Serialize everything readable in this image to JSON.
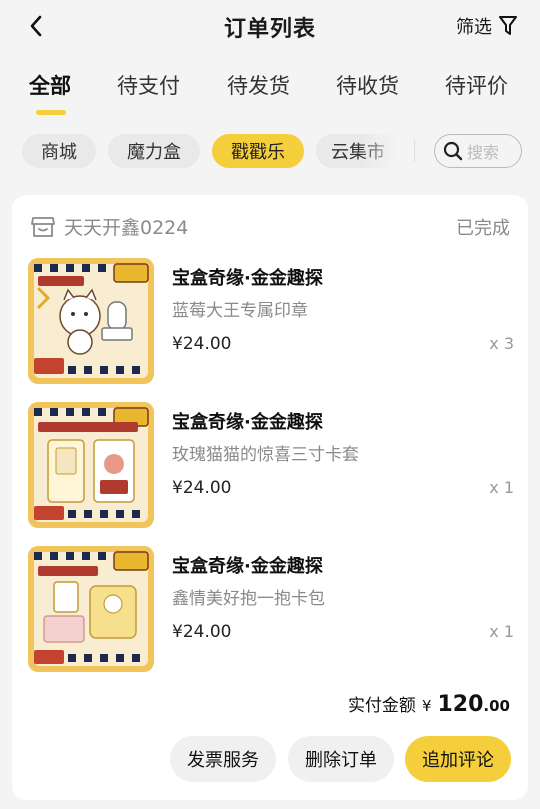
{
  "header": {
    "title": "订单列表",
    "filter_label": "筛选"
  },
  "tabs": [
    {
      "label": "全部",
      "active": true
    },
    {
      "label": "待支付"
    },
    {
      "label": "待发货"
    },
    {
      "label": "待收货"
    },
    {
      "label": "待评价"
    }
  ],
  "chips": [
    {
      "label": "商城"
    },
    {
      "label": "魔力盒"
    },
    {
      "label": "戳戳乐",
      "active": true
    },
    {
      "label": "云集市"
    }
  ],
  "search": {
    "placeholder": "搜索"
  },
  "order": {
    "shop_name": "天天开鑫0224",
    "status": "已完成",
    "items": [
      {
        "title": "宝盒奇缘·金金趣探",
        "subtitle": "蓝莓大王专属印章",
        "price": "¥24.00",
        "qty": "x 3"
      },
      {
        "title": "宝盒奇缘·金金趣探",
        "subtitle": "玫瑰猫猫的惊喜三寸卡套",
        "price": "¥24.00",
        "qty": "x 1"
      },
      {
        "title": "宝盒奇缘·金金趣探",
        "subtitle": "鑫情美好抱一抱卡包",
        "price": "¥24.00",
        "qty": "x 1"
      }
    ],
    "total": {
      "label": "实付金额",
      "currency": "¥",
      "integer": "120",
      "decimal": ".00"
    },
    "actions": {
      "invoice": "发票服务",
      "delete": "删除订单",
      "review": "追加评论"
    }
  },
  "colors": {
    "accent": "#f5cf3b",
    "muted": "#8a8a8a",
    "chip_bg": "#e9e9e9"
  }
}
